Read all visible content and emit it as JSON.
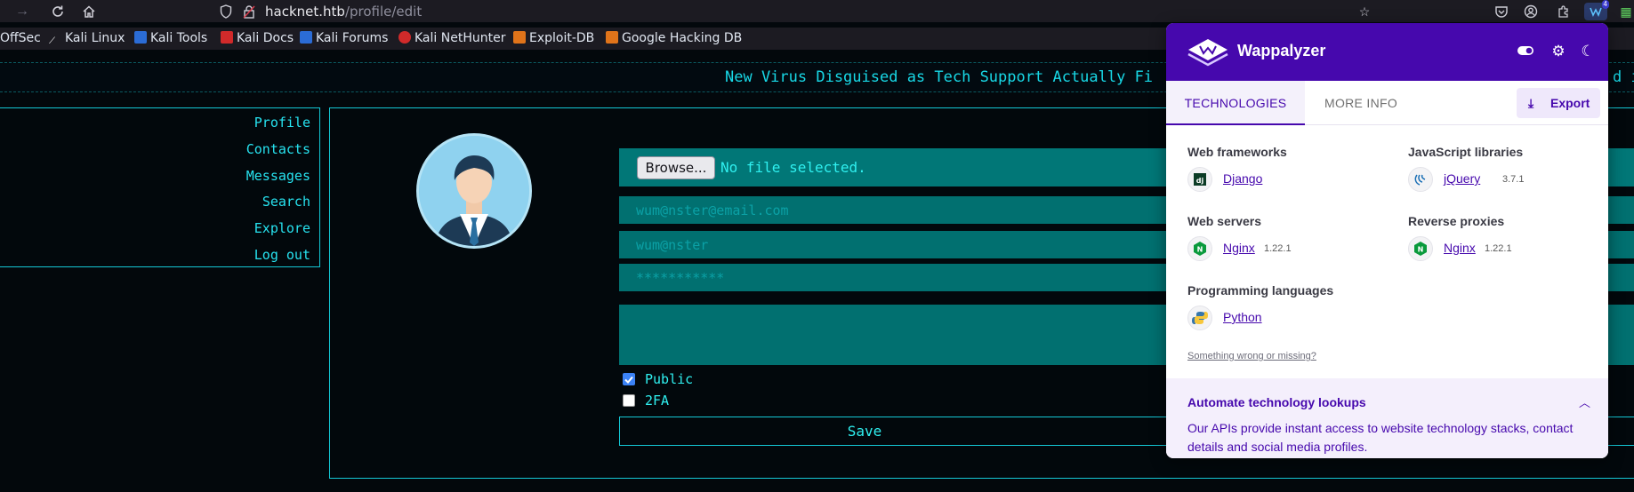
{
  "browser": {
    "url_host": "hacknet.htb",
    "url_path": "/profile/edit",
    "extension_badge": "4",
    "bookmarks": [
      {
        "label": "OffSec",
        "color": "#1c1b22"
      },
      {
        "label": "Kali Linux",
        "color": "#2b6cd6"
      },
      {
        "label": "Kali Tools",
        "color": "#2b6cd6"
      },
      {
        "label": "Kali Docs",
        "color": "#d12a2a"
      },
      {
        "label": "Kali Forums",
        "color": "#2b6cd6"
      },
      {
        "label": "Kali NetHunter",
        "color": "#d12a2a"
      },
      {
        "label": "Exploit-DB",
        "color": "#e0741a"
      },
      {
        "label": "Google Hacking DB",
        "color": "#e0741a"
      }
    ]
  },
  "page": {
    "ticker": "New Virus Disguised as Tech Support Actually Fi",
    "ticker_tail": "d i",
    "sidebar": [
      "Profile",
      "Contacts",
      "Messages",
      "Search",
      "Explore",
      "Log out"
    ],
    "browse_label": "Browse...",
    "file_status": "No file selected.",
    "email_placeholder": "wum@nster@email.com",
    "username_placeholder": "wum@nster",
    "password_placeholder": "***********",
    "public_label": "Public",
    "public_checked": true,
    "twofa_label": "2FA",
    "twofa_checked": false,
    "save_label": "Save"
  },
  "wappalyzer": {
    "title": "Wappalyzer",
    "brand_color": "#4608ad",
    "tabs": {
      "technologies": "TECHNOLOGIES",
      "more_info": "MORE INFO"
    },
    "export_label": "Export",
    "categories": {
      "web_frameworks": {
        "label": "Web frameworks",
        "name": "Django",
        "version": ""
      },
      "js_libraries": {
        "label": "JavaScript libraries",
        "name": "jQuery",
        "version": "3.7.1"
      },
      "web_servers": {
        "label": "Web servers",
        "name": "Nginx",
        "version": "1.22.1"
      },
      "reverse_proxies": {
        "label": "Reverse proxies",
        "name": "Nginx",
        "version": "1.22.1"
      },
      "programming_languages": {
        "label": "Programming languages",
        "name": "Python",
        "version": ""
      }
    },
    "missing_link": "Something wrong or missing?",
    "automate_title": "Automate technology lookups",
    "automate_text": "Our APIs provide instant access to website technology stacks, contact details and social media profiles."
  }
}
